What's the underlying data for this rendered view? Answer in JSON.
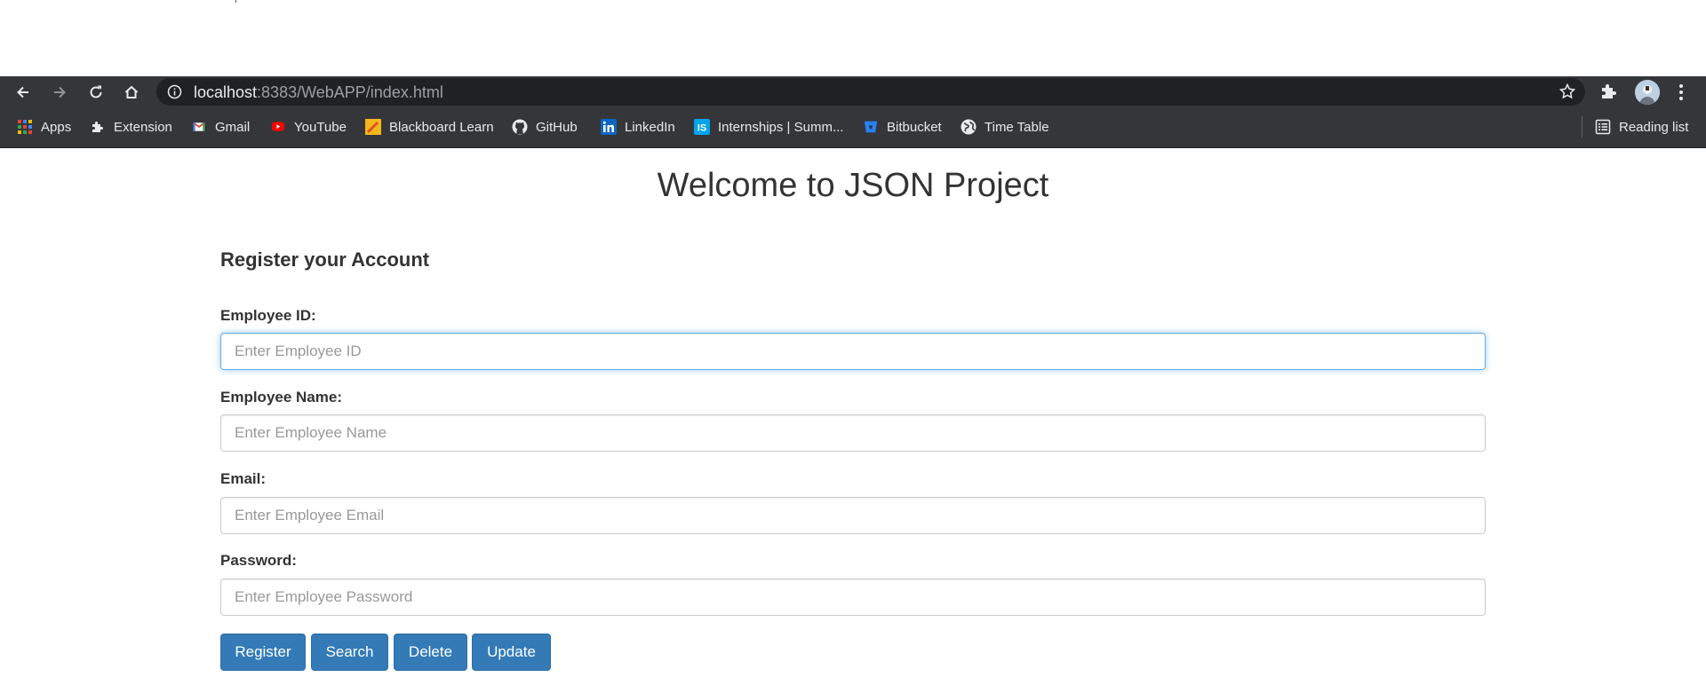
{
  "browser": {
    "url_host": "localhost",
    "url_rest": ":8383/WebAPP/index.html",
    "bookmarks": [
      {
        "label": "Apps",
        "icon": "apps-grid-icon"
      },
      {
        "label": "Extension",
        "icon": "puzzle-icon"
      },
      {
        "label": "Gmail",
        "icon": "gmail-icon"
      },
      {
        "label": "YouTube",
        "icon": "youtube-icon"
      },
      {
        "label": "Blackboard Learn",
        "icon": "blackboard-icon"
      },
      {
        "label": "GitHub",
        "icon": "github-icon"
      },
      {
        "label": "LinkedIn",
        "icon": "linkedin-icon"
      },
      {
        "label": "Internships | Summ...",
        "icon": "internshala-icon"
      },
      {
        "label": "Bitbucket",
        "icon": "bitbucket-icon"
      },
      {
        "label": "Time Table",
        "icon": "globe-icon"
      }
    ],
    "reading_list": "Reading list"
  },
  "page": {
    "title": "Welcome to JSON Project",
    "form_heading": "Register your Account",
    "fields": [
      {
        "label": "Employee ID:",
        "placeholder": "Enter Employee ID",
        "value": ""
      },
      {
        "label": "Employee Name:",
        "placeholder": "Enter Employee Name",
        "value": ""
      },
      {
        "label": "Email:",
        "placeholder": "Enter Employee Email",
        "value": ""
      },
      {
        "label": "Password:",
        "placeholder": "Enter Employee Password",
        "value": ""
      }
    ],
    "buttons": [
      "Register",
      "Search",
      "Delete",
      "Update"
    ]
  },
  "colors": {
    "toolbar": "#35363a",
    "omnibox": "#202124",
    "button_primary": "#337ab7",
    "focus_border": "#66afe9"
  }
}
